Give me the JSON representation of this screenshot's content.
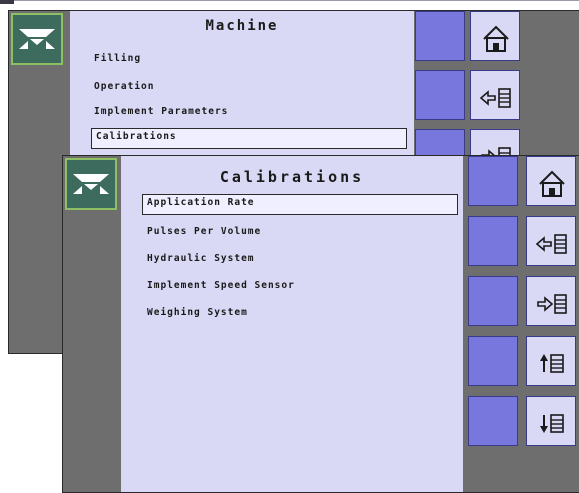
{
  "machine_screen": {
    "title": "Machine",
    "items": [
      "Filling",
      "Operation",
      "Implement Parameters",
      "Calibrations"
    ],
    "selected_item": "Calibrations",
    "icons": [
      "machine-icon",
      "home-icon",
      "back-icon",
      "forward-icon"
    ]
  },
  "calibrations_screen": {
    "title": "Calibrations",
    "items": [
      "Application Rate",
      "Pulses Per Volume",
      "Hydraulic System",
      "Implement Speed Sensor",
      "Weighing System"
    ],
    "selected_item": "Application Rate",
    "icons": [
      "machine-icon",
      "home-icon",
      "back-icon",
      "forward-icon",
      "scroll-up-icon",
      "scroll-down-icon"
    ]
  },
  "colors": {
    "panel_dark": "#6e6e6e",
    "menu_bg": "#d9d9f5",
    "slot_blue": "#7777dd",
    "icon_tile_green": "#3d6b5e"
  }
}
